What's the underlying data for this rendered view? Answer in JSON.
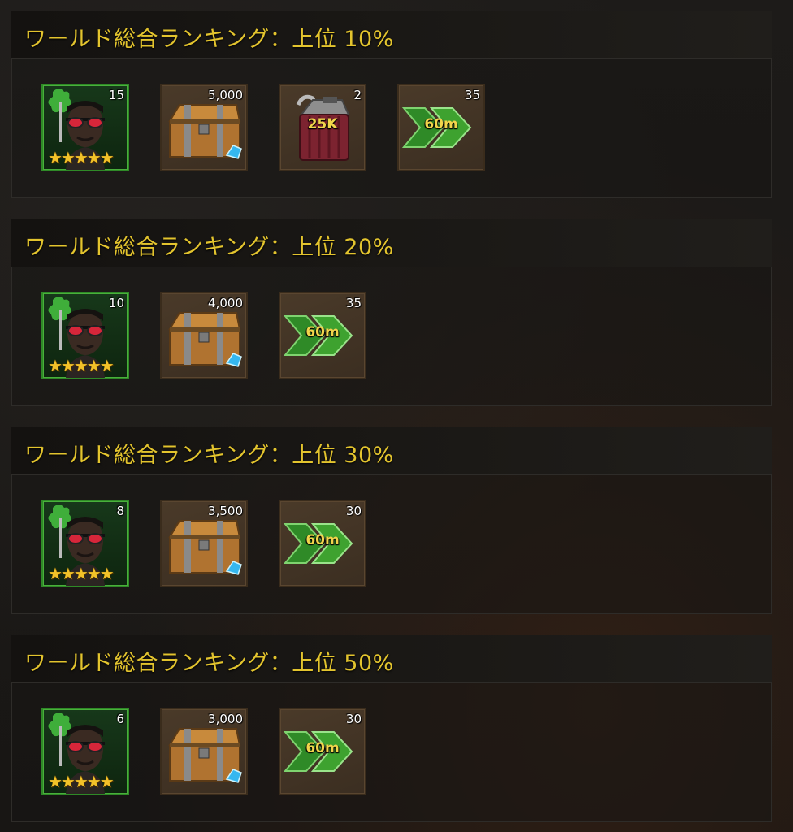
{
  "tiers": [
    {
      "title": "ワールド総合ランキング：上位 10%",
      "rewards": [
        {
          "type": "hero",
          "icon": "hero-portrait-icon",
          "count": "15",
          "stars": "★★★★★"
        },
        {
          "type": "chest",
          "icon": "treasure-chest-icon",
          "count": "5,000"
        },
        {
          "type": "fuel",
          "icon": "fuel-can-icon",
          "count": "2",
          "label": "25K"
        },
        {
          "type": "speedup",
          "icon": "speedup-chevron-icon",
          "count": "35",
          "label": "60m"
        }
      ]
    },
    {
      "title": "ワールド総合ランキング：上位 20%",
      "rewards": [
        {
          "type": "hero",
          "icon": "hero-portrait-icon",
          "count": "10",
          "stars": "★★★★★"
        },
        {
          "type": "chest",
          "icon": "treasure-chest-icon",
          "count": "4,000"
        },
        {
          "type": "speedup",
          "icon": "speedup-chevron-icon",
          "count": "35",
          "label": "60m"
        }
      ]
    },
    {
      "title": "ワールド総合ランキング：上位 30%",
      "rewards": [
        {
          "type": "hero",
          "icon": "hero-portrait-icon",
          "count": "8",
          "stars": "★★★★★"
        },
        {
          "type": "chest",
          "icon": "treasure-chest-icon",
          "count": "3,500"
        },
        {
          "type": "speedup",
          "icon": "speedup-chevron-icon",
          "count": "30",
          "label": "60m"
        }
      ]
    },
    {
      "title": "ワールド総合ランキング：上位 50%",
      "rewards": [
        {
          "type": "hero",
          "icon": "hero-portrait-icon",
          "count": "6",
          "stars": "★★★★★"
        },
        {
          "type": "chest",
          "icon": "treasure-chest-icon",
          "count": "3,000"
        },
        {
          "type": "speedup",
          "icon": "speedup-chevron-icon",
          "count": "30",
          "label": "60m"
        }
      ]
    }
  ],
  "colors": {
    "title": "#e3c42e",
    "hero_border": "#2f8a27",
    "item_border": "#3a2c1c"
  }
}
